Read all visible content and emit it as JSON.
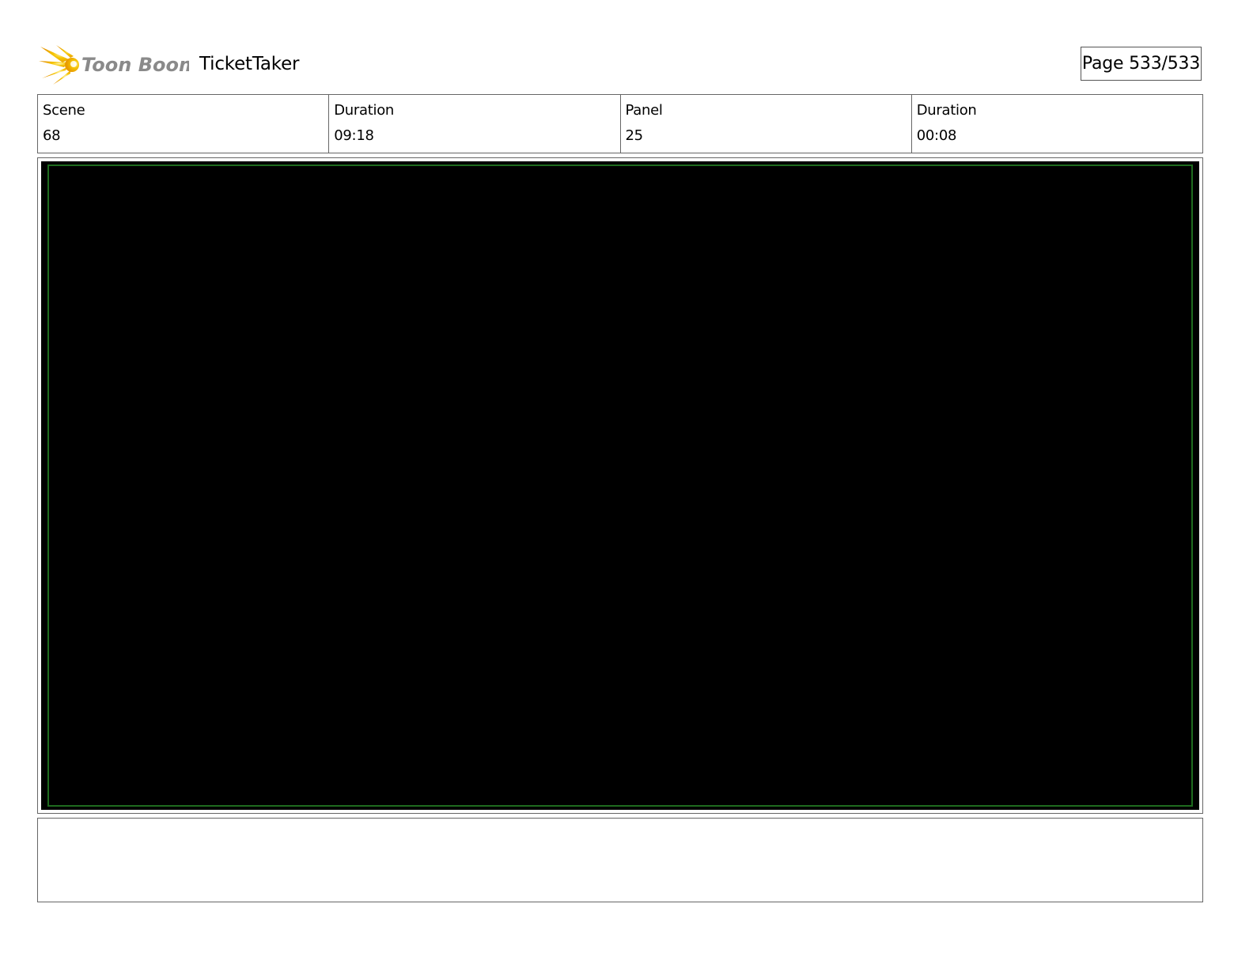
{
  "header": {
    "logo_text": "Toon Boom",
    "project_title": "TicketTaker",
    "page_number": "Page 533/533"
  },
  "info": {
    "scene_label": "Scene",
    "scene_value": "68",
    "scene_duration_label": "Duration",
    "scene_duration_value": "09:18",
    "panel_label": "Panel",
    "panel_value": "25",
    "panel_duration_label": "Duration",
    "panel_duration_value": "00:08"
  },
  "panel": {
    "image_fill": "#000000",
    "safe_area_color": "#1e6b1e"
  },
  "notes": {
    "text": ""
  },
  "colors": {
    "logo_star": "#f5c400",
    "logo_text": "#8a8a8a"
  }
}
